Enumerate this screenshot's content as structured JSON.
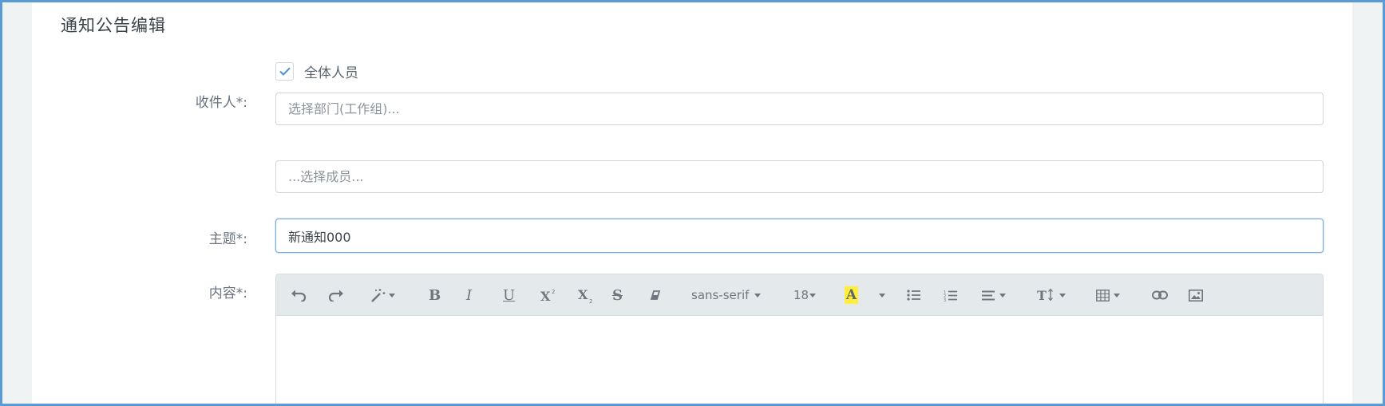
{
  "page": {
    "title": "通知公告编辑"
  },
  "form": {
    "recipients_label": "收件人*:",
    "all_members_label": "全体人员",
    "all_members_checked": true,
    "department_placeholder": "选择部门(工作组)...",
    "member_placeholder": "...选择成员...",
    "subject_label": "主题*:",
    "subject_value": "新通知000",
    "content_label": "内容*:"
  },
  "toolbar": {
    "font_family": "sans-serif",
    "font_size": "18",
    "highlight_color": "#ffef3a",
    "icons": [
      "undo-icon",
      "redo-icon",
      "magic-wand-icon",
      "bold-icon",
      "italic-icon",
      "underline-icon",
      "superscript-icon",
      "subscript-icon",
      "strikethrough-icon",
      "eraser-icon",
      "highlight-icon",
      "unordered-list-icon",
      "ordered-list-icon",
      "align-icon",
      "line-height-icon",
      "table-icon",
      "link-icon",
      "image-icon"
    ]
  },
  "colors": {
    "accent": "#5b9bd5",
    "toolbar_bg": "#e4e9eb",
    "page_bg": "#eff3f4"
  }
}
